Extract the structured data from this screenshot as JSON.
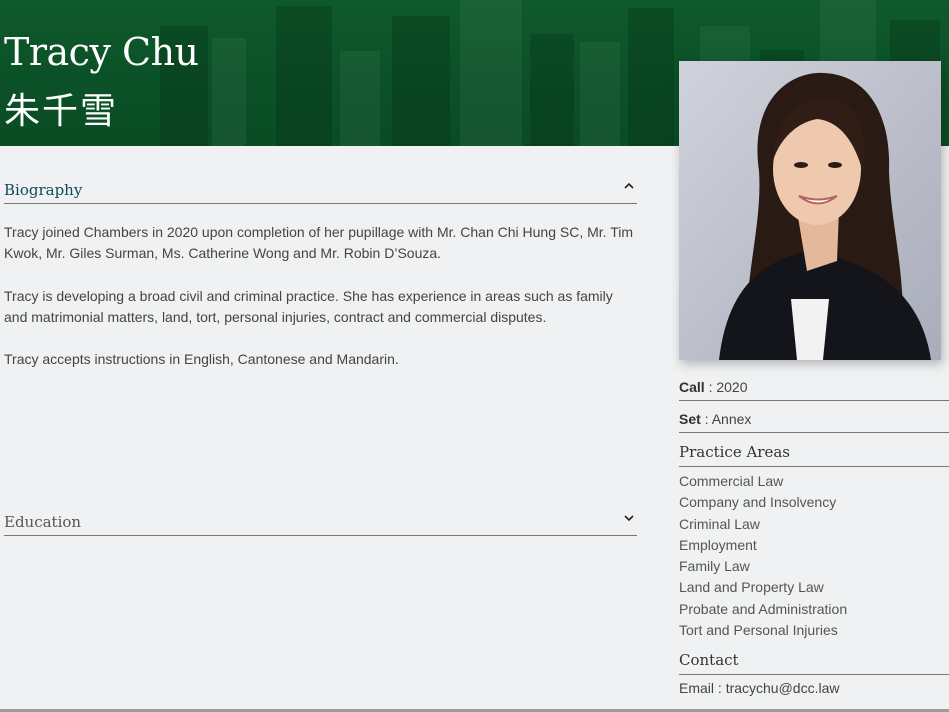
{
  "profile": {
    "name_en": "Tracy Chu",
    "name_zh": "朱千雪"
  },
  "biography": {
    "title": "Biography",
    "expanded": true,
    "paragraphs": [
      "Tracy joined Chambers in 2020 upon completion of her pupillage with Mr. Chan Chi Hung SC, Mr. Tim Kwok, Mr. Giles Surman, Ms. Catherine Wong and Mr. Robin D’Souza.",
      "Tracy is developing a broad civil and criminal practice. She has experience in areas such as family and matrimonial matters, land, tort, personal injuries, contract and commercial disputes.",
      "Tracy accepts instructions in English, Cantonese and Mandarin."
    ]
  },
  "education": {
    "title": "Education",
    "expanded": false
  },
  "details": {
    "call_label": "Call",
    "call_value": "2020",
    "set_label": "Set",
    "set_value": "Annex",
    "separator": " : "
  },
  "practice_areas": {
    "title": "Practice Areas",
    "items": [
      "Commercial Law",
      "Company and Insolvency",
      "Criminal Law",
      "Employment",
      "Family Law",
      "Land and Property Law",
      "Probate and Administration",
      "Tort and Personal Injuries"
    ]
  },
  "contact": {
    "title": "Contact",
    "email_label": "Email",
    "email_value": "tracychu@dcc.law"
  },
  "colors": {
    "header_green": "#0b5127",
    "background": "#eff1f2",
    "biography_title": "#0e4a5a"
  },
  "icons": {
    "biography_toggle": "chevron-up-icon",
    "education_toggle": "chevron-down-icon"
  }
}
